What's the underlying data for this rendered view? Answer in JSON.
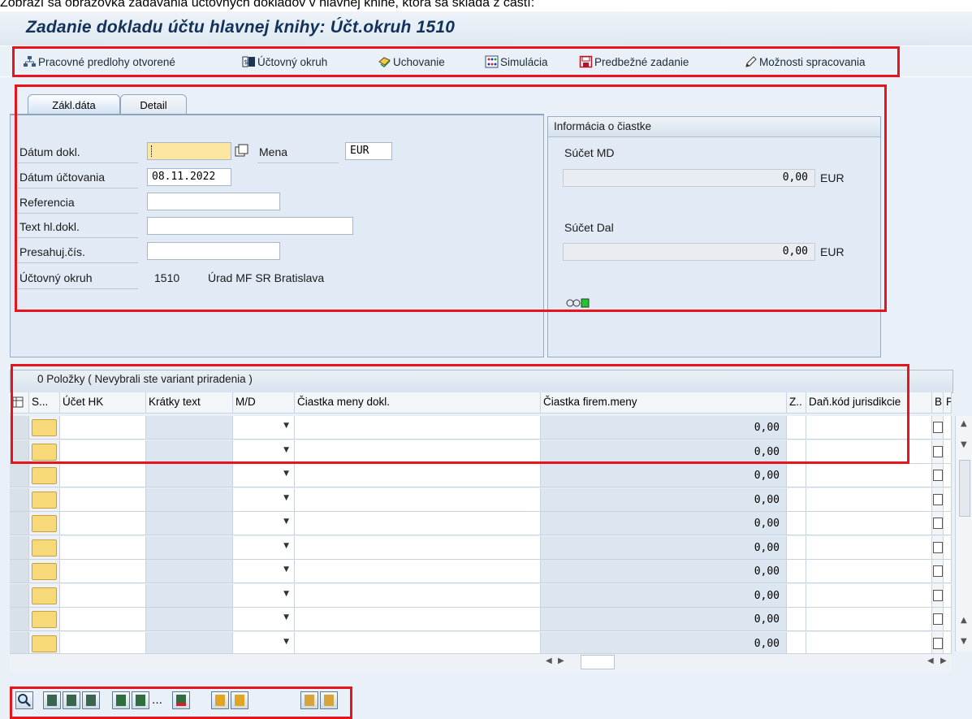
{
  "caption": "Zobrazí sa obrazovka zadávania účtovných dokladov v hlavnej knihe, ktorá sa skladá z častí:",
  "window": {
    "title": "Zadanie dokladu účtu hlavnej knihy: Účt.okruh 1510"
  },
  "toolbar": [
    {
      "label": "Pracovné predlohy otvorené",
      "icon": "tree-icon"
    },
    {
      "label": "Účtovný okruh",
      "icon": "company-code-icon"
    },
    {
      "label": "Uchovanie",
      "icon": "hold-icon"
    },
    {
      "label": "Simulácia",
      "icon": "simulation-icon"
    },
    {
      "label": "Predbežné zadanie",
      "icon": "save-icon"
    },
    {
      "label": "Možnosti spracovania",
      "icon": "pencil-icon"
    }
  ],
  "tabs": [
    {
      "label": "Zákl.dáta",
      "active": true
    },
    {
      "label": "Detail",
      "active": false
    }
  ],
  "header_form": {
    "doc_date_label": "Dátum dokl.",
    "doc_date_value": "",
    "currency_label": "Mena",
    "currency_value": "EUR",
    "posting_date_label": "Dátum účtovania",
    "posting_date_value": "08.11.2022",
    "reference_label": "Referencia",
    "reference_value": "",
    "header_text_label": "Text hl.dokl.",
    "header_text_value": "",
    "cross_cc_label": "Presahuj.čís.",
    "cross_cc_value": "",
    "company_code_label": "Účtovný okruh",
    "company_code_value": "1510",
    "company_code_name": "Úrad MF SR Bratislava"
  },
  "amount_info": {
    "title": "Informácia o čiastke",
    "debit_label": "Súčet MD",
    "debit_value": "0,00",
    "debit_currency": "EUR",
    "credit_label": "Súčet Dal",
    "credit_value": "0,00",
    "credit_currency": "EUR",
    "status_light": "green"
  },
  "items": {
    "title": "0 Položky ( Nevybrali ste variant priradenia )",
    "columns": [
      "S...",
      "Účet HK",
      "Krátky text",
      "M/D",
      "Čiastka meny dokl.",
      "Čiastka firem.meny",
      "Z..",
      "Daň.kód jurisdikcie",
      "B",
      "P"
    ],
    "rows": [
      {
        "local_amount": "0,00"
      },
      {
        "local_amount": "0,00"
      },
      {
        "local_amount": "0,00"
      },
      {
        "local_amount": "0,00"
      },
      {
        "local_amount": "0,00"
      },
      {
        "local_amount": "0,00"
      },
      {
        "local_amount": "0,00"
      },
      {
        "local_amount": "0,00"
      },
      {
        "local_amount": "0,00"
      },
      {
        "local_amount": "0,00"
      }
    ]
  },
  "bottom_toolbar_icons": [
    "details-icon",
    "select-all-icon",
    "deselect-all-icon",
    "select-block-icon",
    "insert-row-icon",
    "insert-rows-icon",
    "more-icon",
    "delete-row-icon",
    "copy-icon",
    "paste-icon",
    "sort-icon",
    "filter-icon"
  ],
  "colors": {
    "highlight": "#e8141c",
    "title": "#12325a",
    "required": "#fbe6a2"
  }
}
